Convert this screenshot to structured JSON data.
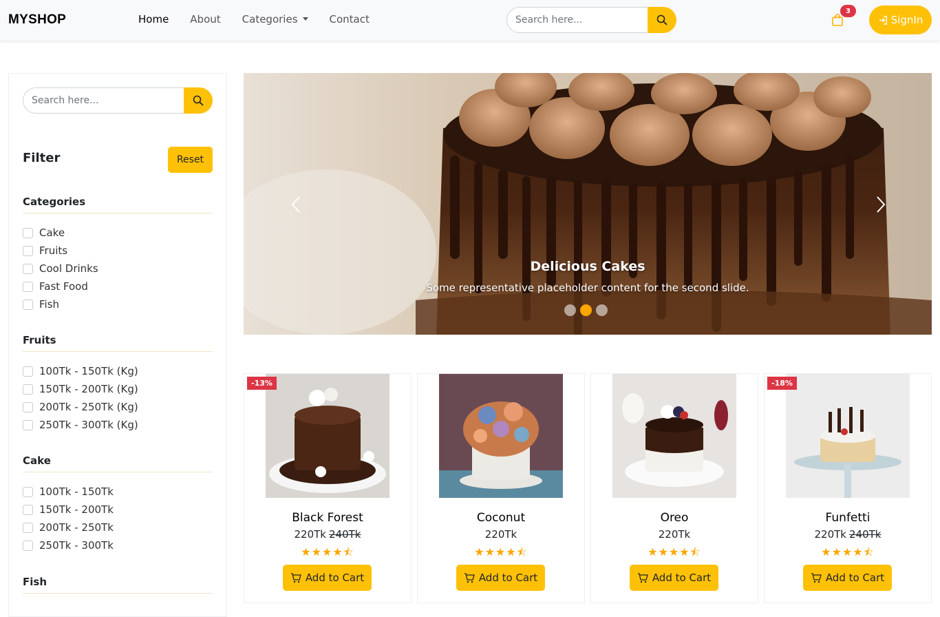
{
  "brand": "MYSHOP",
  "nav": {
    "links": [
      "Home",
      "About",
      "Categories",
      "Contact"
    ],
    "search_placeholder": "Search here...",
    "cart_count": "3",
    "signin_label": "SignIn"
  },
  "sidebar": {
    "search_placeholder": "Search here...",
    "filter_title": "Filter",
    "reset_label": "Reset",
    "groups": [
      {
        "title": "Categories",
        "options": [
          "Cake",
          "Fruits",
          "Cool Drinks",
          "Fast Food",
          "Fish"
        ]
      },
      {
        "title": "Fruits",
        "options": [
          "100Tk - 150Tk (Kg)",
          "150Tk - 200Tk (Kg)",
          "200Tk - 250Tk (Kg)",
          "250Tk - 300Tk (Kg)"
        ]
      },
      {
        "title": "Cake",
        "options": [
          "100Tk - 150Tk",
          "150Tk - 200Tk",
          "200Tk - 250Tk",
          "250Tk - 300Tk"
        ]
      },
      {
        "title": "Fish",
        "options": []
      }
    ]
  },
  "carousel": {
    "title": "Delicious Cakes",
    "text": "Some representative placeholder content for the second slide.",
    "slide_count": 3,
    "active_slide": 2
  },
  "products": [
    {
      "name": "Black Forest",
      "price": "220Tk",
      "old_price": "240Tk",
      "badge": "-13%",
      "rating": 4.5,
      "add_label": "Add to Cart"
    },
    {
      "name": "Coconut",
      "price": "220Tk",
      "old_price": "",
      "badge": "",
      "rating": 4.5,
      "add_label": "Add to Cart"
    },
    {
      "name": "Oreo",
      "price": "220Tk",
      "old_price": "",
      "badge": "",
      "rating": 4.5,
      "add_label": "Add to Cart"
    },
    {
      "name": "Funfetti",
      "price": "220Tk",
      "old_price": "240Tk",
      "badge": "-18%",
      "rating": 4.5,
      "add_label": "Add to Cart"
    }
  ],
  "colors": {
    "accent": "#ffc107",
    "badge": "#dc3545",
    "star": "#ffa500",
    "navbar_bg": "#f8f9fa"
  }
}
